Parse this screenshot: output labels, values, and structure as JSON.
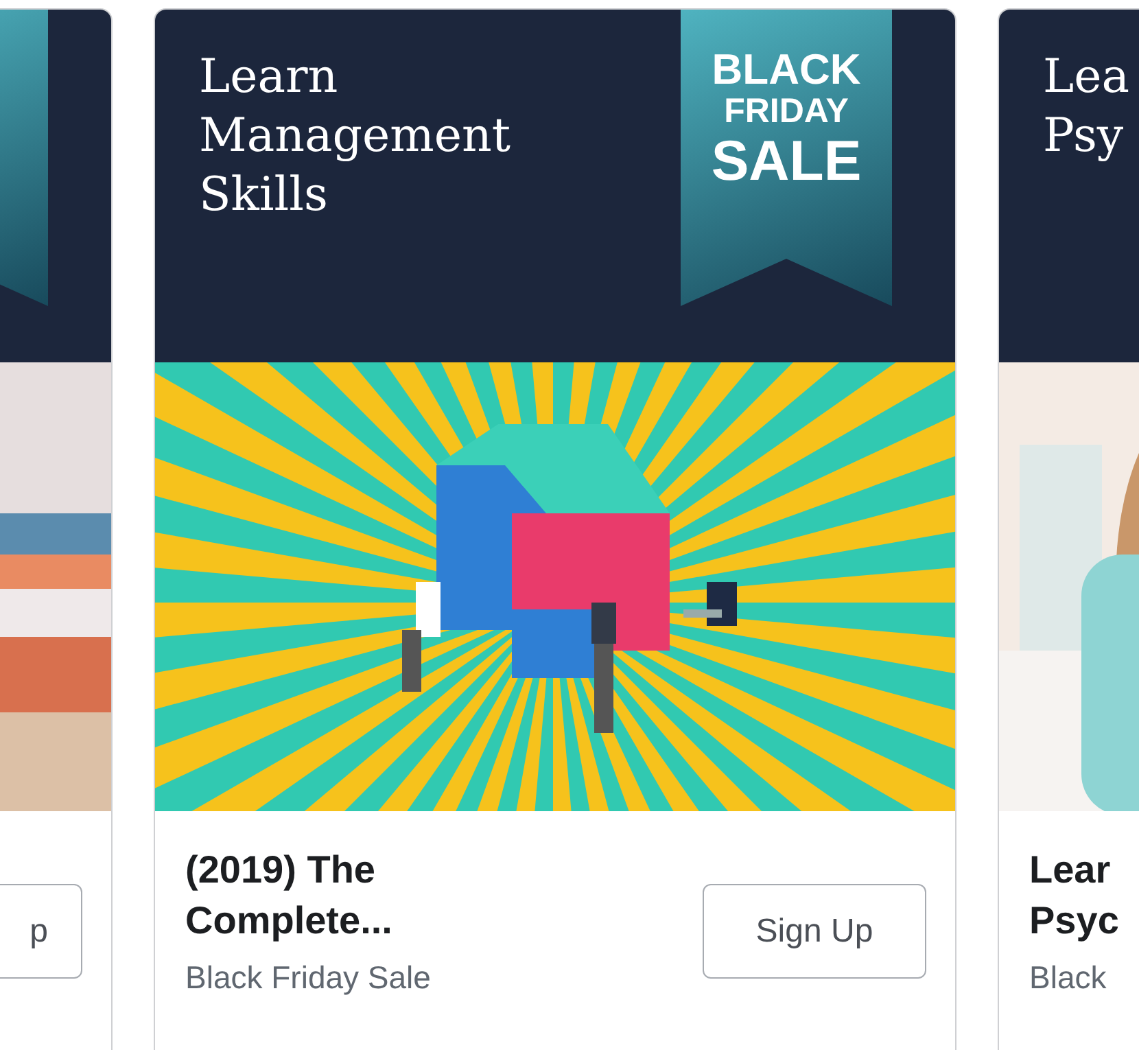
{
  "cards": [
    {
      "ribbon_shown": true,
      "button": "p"
    },
    {
      "headline": "Learn\nManagement\nSkills",
      "ribbon": [
        "BLACK",
        "FRIDAY",
        "SALE"
      ],
      "title": "(2019) The\nComplete...",
      "subtitle": "Black Friday Sale",
      "button": "Sign Up"
    },
    {
      "headline": "Lea\nPsy",
      "title": "Lear\nPsyc",
      "subtitle": "Black"
    }
  ]
}
